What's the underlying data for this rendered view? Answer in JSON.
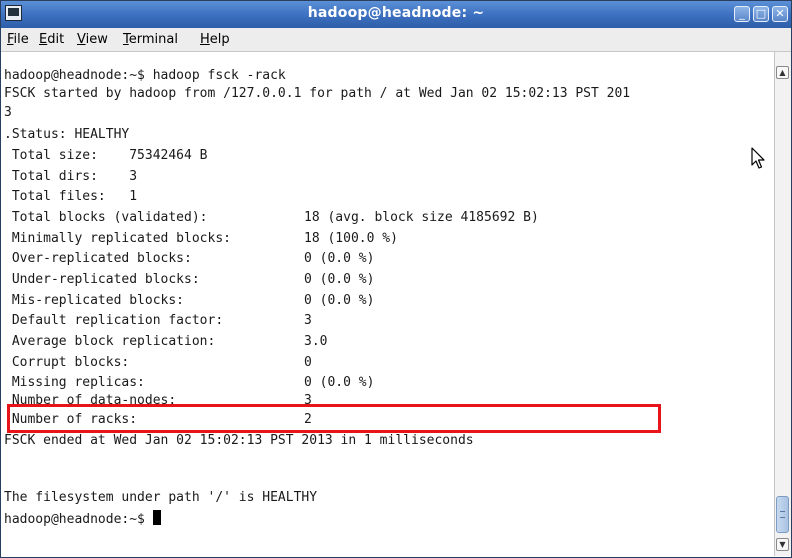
{
  "window": {
    "title": "hadoop@headnode: ~",
    "controls": {
      "minimize": "_",
      "maximize": "□",
      "close": "✕"
    }
  },
  "menu": [
    {
      "mnemonic": "F",
      "rest": "ile"
    },
    {
      "mnemonic": "E",
      "rest": "dit"
    },
    {
      "mnemonic": "V",
      "rest": "iew"
    },
    {
      "mnemonic": "T",
      "rest": "erminal"
    },
    {
      "mnemonic": "H",
      "rest": "elp"
    }
  ],
  "terminal": {
    "prompt_command": "hadoop@headnode:~$ hadoop fsck -rack",
    "fsck_started": "FSCK started by hadoop from /127.0.0.1 for path / at Wed Jan 02 15:02:13 PST 201",
    "fsck_started_wrap": "3",
    "status": ".Status: HEALTHY",
    "total_size": " Total size:    75342464 B",
    "total_dirs": " Total dirs:    3",
    "total_files": " Total files:   1",
    "stats": [
      {
        "label": " Total blocks (validated):",
        "value": "18 (avg. block size 4185692 B)"
      },
      {
        "label": " Minimally replicated blocks:",
        "value": "18 (100.0 %)"
      },
      {
        "label": " Over-replicated blocks:",
        "value": "0 (0.0 %)"
      },
      {
        "label": " Under-replicated blocks:",
        "value": "0 (0.0 %)"
      },
      {
        "label": " Mis-replicated blocks:",
        "value": "0 (0.0 %)"
      },
      {
        "label": " Default replication factor:",
        "value": "3"
      },
      {
        "label": " Average block replication:",
        "value": "3.0"
      },
      {
        "label": " Corrupt blocks:",
        "value": "0"
      },
      {
        "label": " Missing replicas:",
        "value": "0 (0.0 %)"
      },
      {
        "label": " Number of data-nodes:",
        "value": "3"
      },
      {
        "label": " Number of racks:",
        "value": "2"
      }
    ],
    "fsck_ended": "FSCK ended at Wed Jan 02 15:02:13 PST 2013 in 1 milliseconds",
    "filesystem_status": "The filesystem under path '/' is HEALTHY",
    "final_prompt": "hadoop@headnode:~$ "
  },
  "colors": {
    "highlight_border": "#e8141a",
    "titlebar": "#3b6fbf"
  }
}
